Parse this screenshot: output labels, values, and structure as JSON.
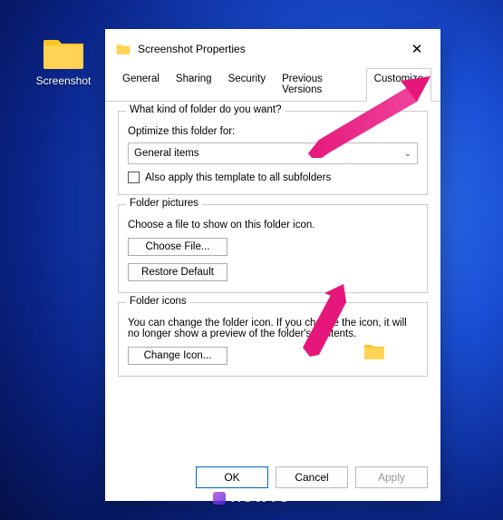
{
  "desktop": {
    "icon_name": "Screenshot"
  },
  "window": {
    "title": "Screenshot Properties",
    "tabs": [
      "General",
      "Sharing",
      "Security",
      "Previous Versions",
      "Customize"
    ],
    "active_tab": 4,
    "group_kind": {
      "legend": "What kind of folder do you want?",
      "optimize_label": "Optimize this folder for:",
      "dropdown_value": "General items",
      "checkbox_label": "Also apply this template to all subfolders"
    },
    "group_pictures": {
      "legend": "Folder pictures",
      "desc": "Choose a file to show on this folder icon.",
      "choose_btn": "Choose File...",
      "restore_btn": "Restore Default"
    },
    "group_icons": {
      "legend": "Folder icons",
      "desc": "You can change the folder icon. If you change the icon, it will no longer show a preview of the folder's contents.",
      "change_btn": "Change Icon..."
    },
    "footer": {
      "ok": "OK",
      "cancel": "Cancel",
      "apply": "Apply"
    }
  },
  "watermark": "HOWTO",
  "annotations": {
    "arrow_color": "#e6177a"
  }
}
